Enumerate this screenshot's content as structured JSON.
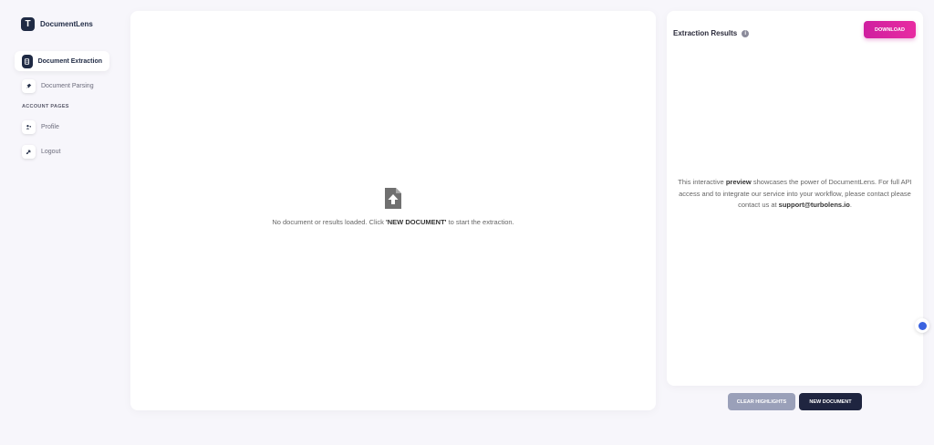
{
  "app": {
    "logo_letter": "T",
    "name": "DocumentLens"
  },
  "sidebar": {
    "items": [
      {
        "label": "Document Extraction",
        "icon": "document-icon",
        "active": true
      },
      {
        "label": "Document Parsing",
        "icon": "pin-icon",
        "active": false
      }
    ],
    "section_label": "ACCOUNT PAGES",
    "account_items": [
      {
        "label": "Profile",
        "icon": "user-icon"
      },
      {
        "label": "Logout",
        "icon": "logout-icon"
      }
    ]
  },
  "document": {
    "empty_text_before": "No document or results loaded. Click ",
    "empty_text_bold": "'NEW DOCUMENT'",
    "empty_text_after": " to start the extraction."
  },
  "results": {
    "title": "Extraction Results",
    "download_label": "DOWNLOAD",
    "preview_before": "This interactive ",
    "preview_bold": "preview",
    "preview_middle": " showcases the power of DocumentLens. For full API access and to integrate our service into your workflow, please contact please contact us at ",
    "preview_email": "support@turbolens.io",
    "preview_end": "."
  },
  "actions": {
    "clear_label": "CLEAR HIGHLIGHTS",
    "new_label": "NEW DOCUMENT"
  },
  "colors": {
    "accent": "#e82ba1",
    "dark": "#1f2540",
    "muted_button": "#9aa0b9"
  }
}
